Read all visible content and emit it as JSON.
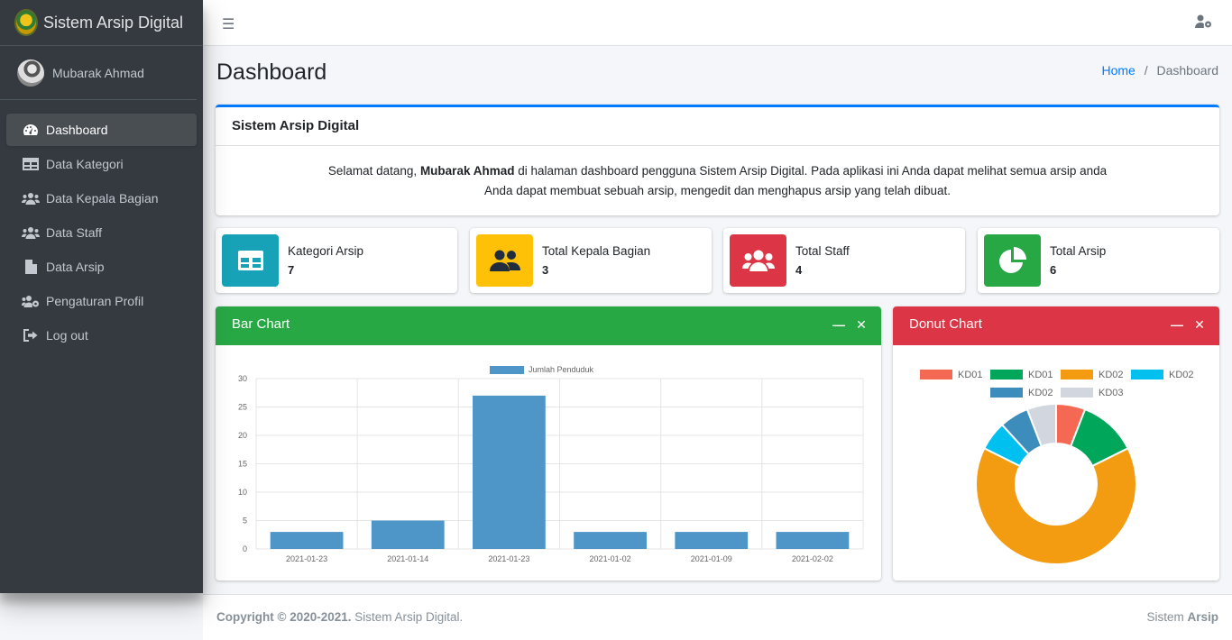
{
  "app": {
    "brand": "Sistem Arsip Digital",
    "user_name": "Mubarak Ahmad"
  },
  "sidebar": {
    "items": [
      {
        "label": "Dashboard",
        "icon": "tachometer-icon",
        "active": true
      },
      {
        "label": "Data Kategori",
        "icon": "table-icon"
      },
      {
        "label": "Data Kepala Bagian",
        "icon": "users-icon"
      },
      {
        "label": "Data Staff",
        "icon": "users-icon"
      },
      {
        "label": "Data Arsip",
        "icon": "file-icon"
      },
      {
        "label": "Pengaturan Profil",
        "icon": "users-cog-icon"
      },
      {
        "label": "Log out",
        "icon": "sign-out-icon"
      }
    ]
  },
  "header": {
    "title": "Dashboard",
    "breadcrumb": {
      "home": "Home",
      "separator": "/",
      "current": "Dashboard"
    }
  },
  "welcome": {
    "title": "Sistem Arsip Digital",
    "line1_prefix": "Selamat datang, ",
    "line1_name": "Mubarak Ahmad",
    "line1_suffix": " di halaman dashboard pengguna Sistem Arsip Digital. Pada aplikasi ini Anda dapat melihat semua arsip anda",
    "line2": "Anda dapat membuat sebuah arsip, mengedit dan menghapus arsip yang telah dibuat."
  },
  "stats": [
    {
      "label": "Kategori Arsip",
      "value": "7",
      "color": "#17a2b8",
      "icon": "table-icon"
    },
    {
      "label": "Total Kepala Bagian",
      "value": "3",
      "color": "#ffc107",
      "icon": "users-icon"
    },
    {
      "label": "Total Staff",
      "value": "4",
      "color": "#dc3545",
      "icon": "users-icon"
    },
    {
      "label": "Total Arsip",
      "value": "6",
      "color": "#28a745",
      "icon": "pie-chart-icon"
    }
  ],
  "bar_card": {
    "title": "Bar Chart",
    "color": "#28a745",
    "minimize": "—",
    "close": "✕"
  },
  "donut_card": {
    "title": "Donut Chart",
    "color": "#dc3545",
    "minimize": "—",
    "close": "✕"
  },
  "chart_data": [
    {
      "type": "bar",
      "categories": [
        "2021-01-23",
        "2021-01-14",
        "2021-01-23",
        "2021-01-02",
        "2021-01-09",
        "2021-02-02"
      ],
      "series": [
        {
          "name": "Jumlah Penduduk",
          "values": [
            3,
            5,
            27,
            3,
            3,
            3
          ],
          "color": "#4e96c8"
        }
      ],
      "ylim": [
        0,
        30
      ],
      "yticks": [
        0,
        5,
        10,
        15,
        20,
        25,
        30
      ],
      "grid": true,
      "legend": "top"
    },
    {
      "type": "pie",
      "donut": true,
      "labels": [
        "KD01",
        "KD01",
        "KD02",
        "KD02",
        "KD02",
        "KD03"
      ],
      "values": [
        1,
        2,
        11,
        1,
        1,
        1
      ],
      "colors": [
        "#f56954",
        "#00a65a",
        "#f39c12",
        "#00c0ef",
        "#3c8dbc",
        "#d2d6de"
      ],
      "legend": "top"
    }
  ],
  "footer": {
    "copyright_bold": "Copyright © 2020-2021.",
    "copyright_rest": " Sistem Arsip Digital.",
    "right_prefix": "Sistem ",
    "right_bold": "Arsip"
  }
}
